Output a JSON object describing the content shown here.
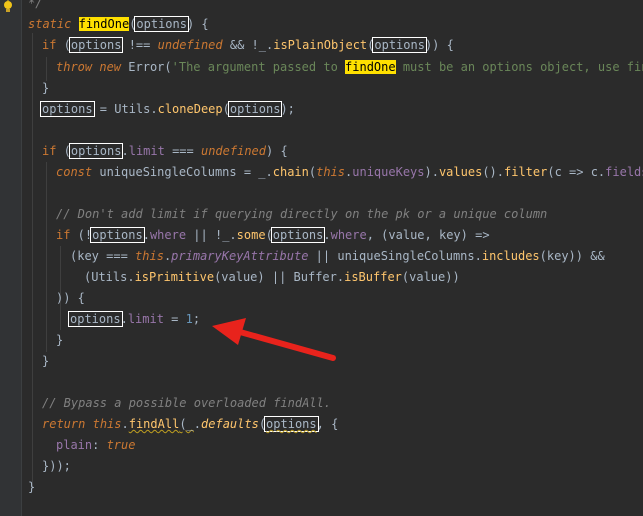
{
  "editor": {
    "top_comment": "*/",
    "lines": {
      "l1": {
        "static": "static",
        "fn": "findOne",
        "p": "(",
        "param": "options",
        "rest": ") {"
      },
      "l2": {
        "if": "if",
        "p1": " (",
        "opt": "options",
        "op": " !== ",
        "undef": "undefined",
        "and": " && !_.",
        "method": "isPlainObject",
        "p2": "(",
        "opt2": "options",
        "end": ")) {"
      },
      "l3": {
        "throw": "throw",
        "sp": " ",
        "new": "new",
        "cls": " Error(",
        "str1": "'The argument passed to ",
        "hl": "findOne",
        "str2": " must be an options object, use findB"
      },
      "l4": {
        "text": "}"
      },
      "l5": {
        "opt": "options",
        "eq": " = Utils.",
        "method": "cloneDeep",
        "p": "(",
        "opt2": "options",
        "end": ");"
      },
      "l7": {
        "if": "if",
        "p1": " (",
        "opt": "options",
        "dot": ".",
        "limit": "limit",
        "op": " === ",
        "undef": "undefined",
        "end": ") {"
      },
      "l8": {
        "const": "const",
        "var": " uniqueSingleColumns = _.",
        "chain": "chain",
        "p1": "(",
        "this": "this",
        "dot": ".",
        "uk": "uniqueKeys",
        "p2": ").",
        "values": "values",
        "p3": "().",
        "filter": "filter",
        "p4": "(c => c.",
        "fields": "fields",
        "end": ".l"
      },
      "l10": {
        "text": "// Don't add limit if querying directly on the pk or a unique column"
      },
      "l11": {
        "if": "if",
        "p1": " (!",
        "opt": "options",
        "dot": ".",
        "where": "where",
        "or": " || !_.",
        "some": "some",
        "p2": "(",
        "opt2": "options",
        "dot2": ".",
        "where2": "where",
        "end": ", (value, key) =>"
      },
      "l12": {
        "p1": "(key === ",
        "this": "this",
        "dot": ".",
        "pka": "primaryKeyAttribute",
        "or": " || uniqueSingleColumns.",
        "includes": "includes",
        "end": "(key)) &&"
      },
      "l13": {
        "p1": "(Utils.",
        "isprim": "isPrimitive",
        "mid": "(value) || Buffer.",
        "isbuf": "isBuffer",
        "end": "(value))"
      },
      "l14": {
        "text": ")) {"
      },
      "l15": {
        "opt": "options",
        "dot": ".",
        "limit": "limit",
        "eq": " = ",
        "num": "1",
        "end": ";"
      },
      "l16": {
        "text": "}"
      },
      "l17": {
        "text": "}"
      },
      "l19": {
        "text": "// Bypass a possible overloaded findAll."
      },
      "l20": {
        "return": "return",
        "sp": " ",
        "this": "this",
        "dot": ".",
        "findall": "findAll",
        "p1": "(",
        "under": "_",
        "dot2": ".",
        "defaults": "defaults",
        "p2": "(",
        "opt": "options",
        "end": ", {"
      },
      "l21": {
        "plain": "plain",
        "colon": ": ",
        "true": "true"
      },
      "l22": {
        "text": "}));"
      },
      "l23": {
        "text": "}"
      }
    }
  },
  "colors": {
    "background": "#2b2b2b",
    "gutter": "#313335",
    "keyword": "#cc7832",
    "function": "#ffc66d",
    "property": "#9876aa",
    "string": "#6a8759",
    "number": "#6897bb",
    "comment": "#808080",
    "highlight": "#ffe000",
    "arrow": "#e8231c"
  },
  "icons": {
    "bulb": "lightbulb-icon",
    "arrow": "red-arrow-annotation"
  }
}
